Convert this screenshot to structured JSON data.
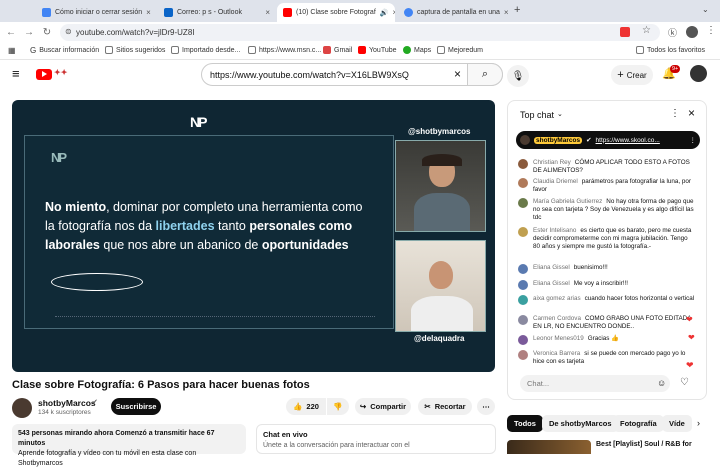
{
  "tabs": [
    {
      "title": "Cómo iniciar o cerrar sesión"
    },
    {
      "title": "Correo: p s - Outlook"
    },
    {
      "title": "(10) Clase sobre Fotograf"
    },
    {
      "title": "captura de pantalla en una"
    }
  ],
  "address": {
    "url": "youtube.com/watch?v=jlDr9-UZ8I"
  },
  "bookmarks": [
    "Buscar información",
    "Sitios sugeridos",
    "Importado desde...",
    "https://www.msn.c...",
    "Gmail",
    "YouTube",
    "Maps",
    "Mejoredum"
  ],
  "bookmarks_all": "Todos los favoritos",
  "yt": {
    "search_value": "https://www.youtube.com/watch?v=X16LBW9XsQ",
    "create_label": "Crear",
    "notif_count": "9+"
  },
  "video": {
    "handle_top": "@shotbymarcos",
    "handle_bottom": "@delaquadra",
    "slide_parts": [
      {
        "t": "No miento",
        "b": true,
        "h": false
      },
      {
        "t": ", dominar por completo una herramienta como la fotografía nos da ",
        "b": false,
        "h": false
      },
      {
        "t": "libertades",
        "b": true,
        "h": true
      },
      {
        "t": " tanto ",
        "b": false,
        "h": false
      },
      {
        "t": "personales como laborales",
        "b": true,
        "h": false
      },
      {
        "t": " que nos abre un abanico de ",
        "b": false,
        "h": false
      },
      {
        "t": "oportunidades",
        "b": true,
        "h": false
      }
    ]
  },
  "meta": {
    "title": "Clase sobre Fotografía: 6 Pasos para hacer buenas fotos",
    "channel": "shotbyMarcos",
    "subs": "134 k suscriptores",
    "subscribe": "Suscribirse",
    "likes": "220",
    "share": "Compartir",
    "clip": "Recortar"
  },
  "description": {
    "line1": "543 personas mirando ahora  Comenzó a transmitir hace 67 minutos",
    "line2": "Aprende fotografía y vídeo con tu móvil en esta clase con Shotbymarcos"
  },
  "chatlive": {
    "title": "Chat en vivo",
    "line": "Únete a la conversación para interactuar con el"
  },
  "chat": {
    "header": "Top chat",
    "pinned_author": "shotbyMarcos",
    "pinned_link": "https://www.skool.co...",
    "input_placeholder": "Chat...",
    "messages": [
      {
        "author": "Christian Rey",
        "text": "CÓMO APLICAR TODO ESTO A FOTOS DE ALIMENTOS?",
        "color": "#8a5a3c"
      },
      {
        "author": "Claudia Driemel",
        "text": "parámetros para fotografiar la luna, por favor",
        "color": "#b07a5a"
      },
      {
        "author": "María Gabriela Gutierrez",
        "text": "No hay otra forma de pago que no sea con tarjeta ? Soy de Venezuela y es algo difícil las tdc",
        "color": "#6a7a4a"
      },
      {
        "author": "Ester Intelisano",
        "text": "es cierto que es barato, pero me cuesta decidir comprometerme con mi magra jubilación. Tengo 80 años y siempre me gustó la fotografía.-",
        "color": "#c0a050"
      },
      {
        "author": "Eliana Gissel",
        "text": "buenisimo!!!",
        "color": "#5a7ab0"
      },
      {
        "author": "Eliana Gissel",
        "text": "Me voy a inscribir!!!",
        "color": "#5a7ab0"
      },
      {
        "author": "aixa gomez arias",
        "text": "cuando hacer fotos horizontal o vertical",
        "color": "#3aa0a0"
      },
      {
        "author": "Carmen Cordova",
        "text": "COMO GRABO UNA FOTO EDITADA EN LR, NO ENCUENTRO DONDE..",
        "color": "#8a8aa0"
      },
      {
        "author": "Leonor Menes019",
        "text": "Gracias 👍",
        "color": "#7a5a9a"
      },
      {
        "author": "Veronica Barrera",
        "text": "si se puede con mercado pago yo lo hice con es tarjeta",
        "color": "#b08080"
      }
    ]
  },
  "chips": [
    "Todos",
    "De shotbyMarcos",
    "Fotografía",
    "Víde"
  ],
  "rec": {
    "title": "Best [Playlist] Soul / R&B for"
  }
}
